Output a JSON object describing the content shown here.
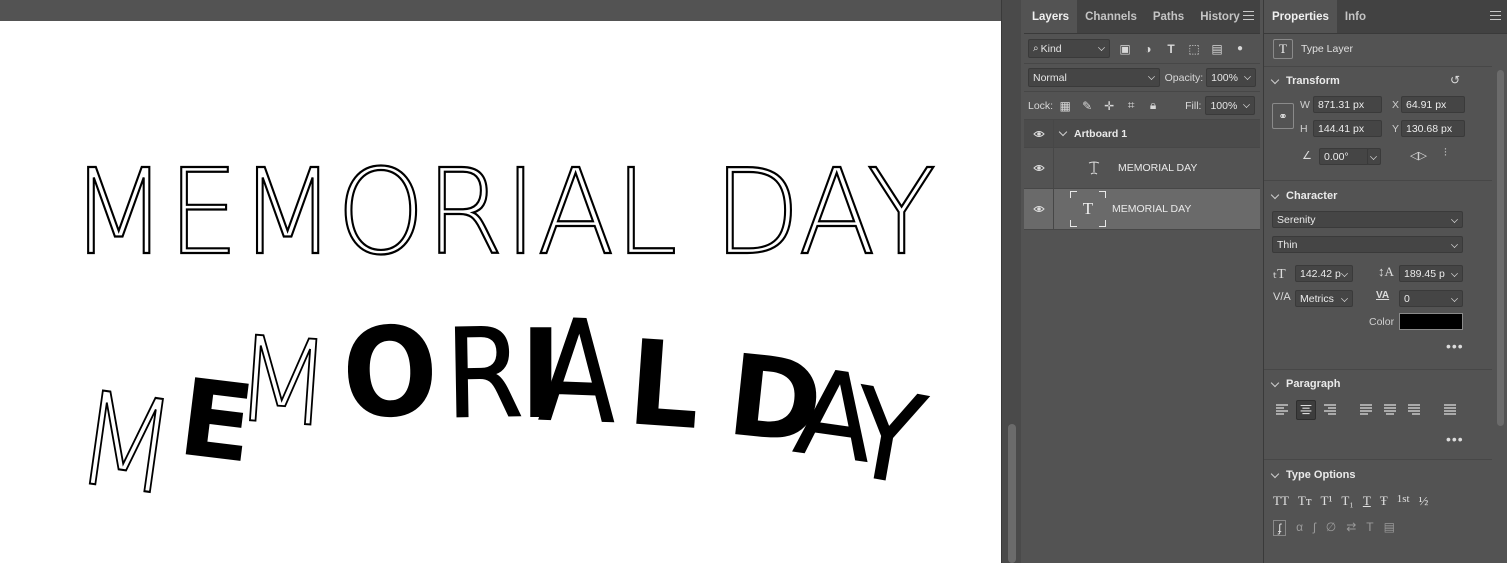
{
  "canvas": {
    "text_top": "MEMORIAL DAY",
    "text_warped": [
      "M",
      "E",
      "M",
      "O",
      "R",
      "I",
      "A",
      "L",
      "D",
      "A",
      "Y"
    ]
  },
  "layers_panel": {
    "tabs": [
      "Layers",
      "Channels",
      "Paths",
      "History"
    ],
    "filter": {
      "kind_label": "Kind"
    },
    "blend_mode": "Normal",
    "opacity_label": "Opacity:",
    "opacity_value": "100%",
    "lock_label": "Lock:",
    "fill_label": "Fill:",
    "fill_value": "100%",
    "artboard_name": "Artboard 1",
    "layers": [
      {
        "name": "MEMORIAL DAY",
        "icon": "warped-text-icon",
        "selected": false
      },
      {
        "name": "MEMORIAL DAY",
        "icon": "type-layer-thumbnail",
        "selected": true
      }
    ]
  },
  "properties_panel": {
    "tabs": [
      "Properties",
      "Info"
    ],
    "layer_type": "Type Layer",
    "transform": {
      "title": "Transform",
      "w_label": "W",
      "w_value": "871.31 px",
      "x_label": "X",
      "x_value": "64.91 px",
      "h_label": "H",
      "h_value": "144.41 px",
      "y_label": "Y",
      "y_value": "130.68 px",
      "angle_value": "0.00°"
    },
    "character": {
      "title": "Character",
      "font_family": "Serenity",
      "font_style": "Thin",
      "font_size": "142.42 p",
      "leading": "189.45 p",
      "kerning": "Metrics",
      "tracking": "0",
      "color_label": "Color",
      "color_hex": "#000000"
    },
    "paragraph": {
      "title": "Paragraph"
    },
    "type_options": {
      "title": "Type Options",
      "buttons": [
        "TT",
        "Tт",
        "T¹",
        "T₁",
        "T",
        "Ŧ",
        "1st",
        "½"
      ]
    }
  }
}
